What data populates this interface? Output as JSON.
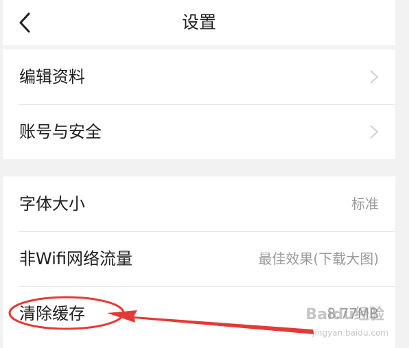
{
  "header": {
    "title": "设置"
  },
  "group1": {
    "items": [
      {
        "label": "编辑资料"
      },
      {
        "label": "账号与安全"
      }
    ]
  },
  "group2": {
    "items": [
      {
        "label": "字体大小",
        "value": "标准"
      },
      {
        "label": "非Wifi网络流量",
        "value": "最佳效果(下载大图)"
      },
      {
        "label": "清除缓存",
        "value": "8.77MB"
      }
    ]
  },
  "watermark": {
    "text": "Baidu经验",
    "sub": "jingyan.baidu.com"
  },
  "colors": {
    "annotation": "#e53935",
    "background": "#f2f2f2",
    "card": "#ffffff"
  },
  "icons": {
    "back": "chevron-left-icon",
    "disclosure": "chevron-right-icon"
  }
}
